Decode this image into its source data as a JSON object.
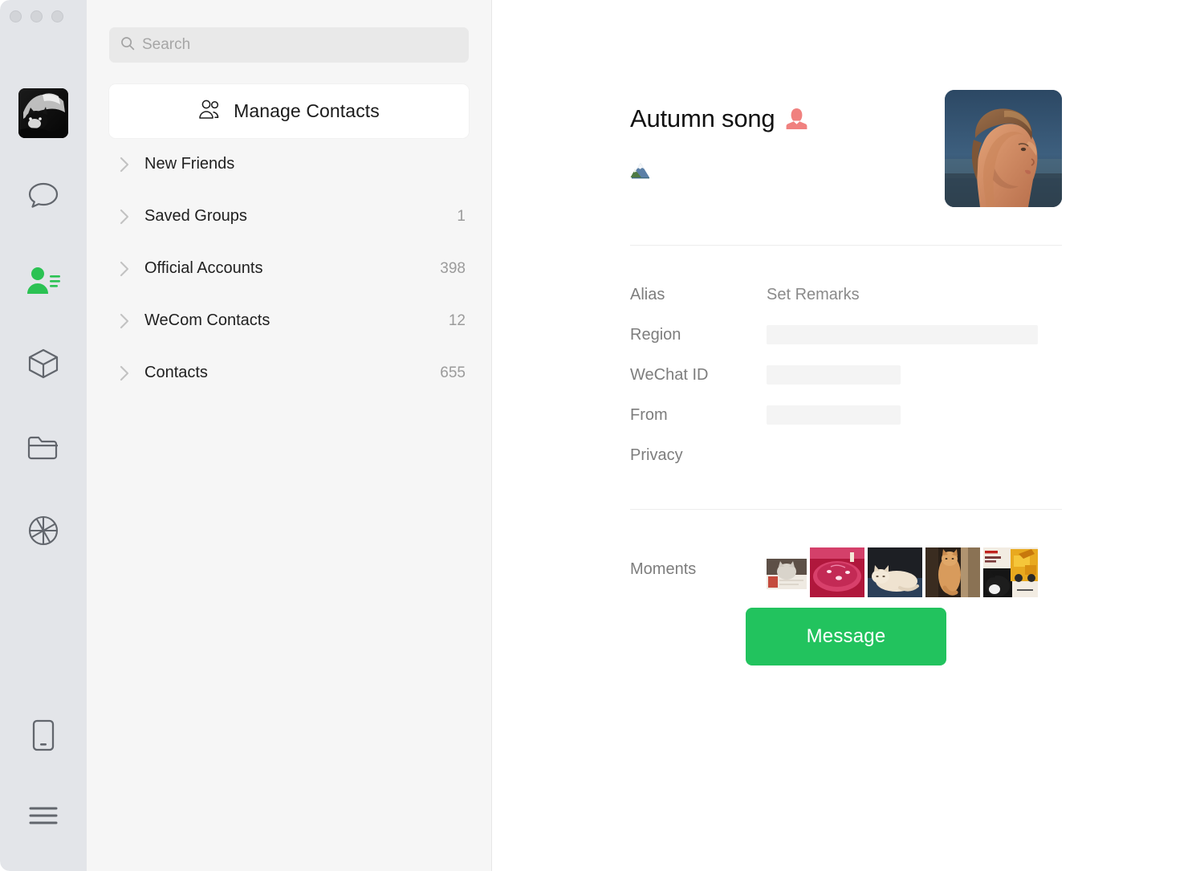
{
  "window": {
    "traffic_lights": [
      "close",
      "minimize",
      "maximize"
    ]
  },
  "nav_rail": {
    "avatar_name": "user-avatar-cat-photo",
    "items": [
      {
        "name": "chats",
        "icon": "chat-bubble-icon",
        "active": false
      },
      {
        "name": "contacts",
        "icon": "contacts-icon",
        "active": true
      },
      {
        "name": "mini-programs",
        "icon": "box-icon",
        "active": false
      },
      {
        "name": "favorites",
        "icon": "folder-icon",
        "active": false
      },
      {
        "name": "moments",
        "icon": "aperture-icon",
        "active": false
      }
    ],
    "bottom_items": [
      {
        "name": "phone",
        "icon": "phone-icon"
      },
      {
        "name": "menu",
        "icon": "hamburger-menu-icon"
      }
    ]
  },
  "search": {
    "placeholder": "Search",
    "value": "",
    "icon": "search-icon"
  },
  "manage_contacts": {
    "label": "Manage Contacts",
    "icon": "two-people-icon"
  },
  "contact_groups": [
    {
      "label": "New Friends",
      "count": "",
      "icon": "chevron-right-icon"
    },
    {
      "label": "Saved Groups",
      "count": "1",
      "icon": "chevron-right-icon"
    },
    {
      "label": "Official Accounts",
      "count": "398",
      "icon": "chevron-right-icon"
    },
    {
      "label": "WeCom Contacts",
      "count": "12",
      "icon": "chevron-right-icon"
    },
    {
      "label": "Contacts",
      "count": "655",
      "icon": "chevron-right-icon"
    }
  ],
  "contact_detail": {
    "name": "Autumn song",
    "gender_icon": "female-avatar-icon",
    "gender_color": "#f0817f",
    "signature_emoji": "snow-capped-mountain-emoji",
    "profile_photo": "woman-profile-at-dusk-photo",
    "fields": [
      {
        "label": "Alias",
        "value": "Set Remarks",
        "redacted": false,
        "redact_width": ""
      },
      {
        "label": "Region",
        "value": "",
        "redacted": true,
        "redact_width": "wide"
      },
      {
        "label": "WeChat ID",
        "value": "",
        "redacted": true,
        "redact_width": "mid"
      },
      {
        "label": "From",
        "value": "",
        "redacted": true,
        "redact_width": "mid"
      },
      {
        "label": "Privacy",
        "value": "",
        "redacted": false,
        "redact_width": ""
      }
    ],
    "moments": {
      "label": "Moments",
      "thumbnails": [
        {
          "name": "moment-thumb-cat-in-box",
          "size": "small"
        },
        {
          "name": "moment-thumb-red-bowl",
          "size": "big"
        },
        {
          "name": "moment-thumb-sleeping-cat",
          "size": "big"
        },
        {
          "name": "moment-thumb-cat-on-chair",
          "size": "big"
        },
        {
          "name": "moment-thumb-cat-poster",
          "size": "big"
        }
      ]
    },
    "message_button": {
      "label": "Message",
      "color": "#22c35e"
    }
  }
}
